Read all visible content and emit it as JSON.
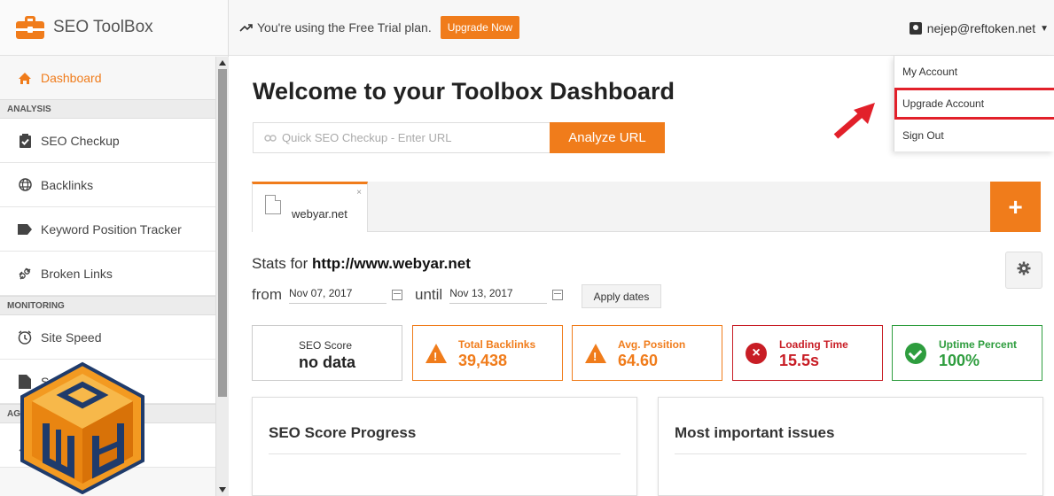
{
  "brand": {
    "name": "SEO ToolBox"
  },
  "sidebar": {
    "items": [
      {
        "label": "Dashboard",
        "icon": "home-icon",
        "active": true
      },
      {
        "section": "ANALYSIS"
      },
      {
        "label": "SEO Checkup",
        "icon": "clipboard-check-icon"
      },
      {
        "label": "Backlinks",
        "icon": "globe-icon"
      },
      {
        "label": "Keyword Position Tracker",
        "icon": "tag-icon"
      },
      {
        "label": "Broken Links",
        "icon": "broken-link-icon"
      },
      {
        "section": "MONITORING"
      },
      {
        "label": "Site Speed",
        "icon": "clock-icon"
      },
      {
        "label": "S",
        "icon": "file-icon"
      },
      {
        "section": "AGE"
      }
    ]
  },
  "topbar": {
    "trial_text": "You're using the Free Trial plan.",
    "upgrade_label": "Upgrade Now",
    "user_email": "nejep@reftoken.net"
  },
  "dropdown": {
    "items": [
      "My Account",
      "Upgrade Account",
      "Sign Out"
    ]
  },
  "main": {
    "title": "Welcome to your Toolbox Dashboard",
    "search": {
      "placeholder": "Quick SEO Checkup - Enter URL",
      "button": "Analyze URL"
    },
    "tab": {
      "label": "webyar.net",
      "close": "×"
    },
    "add_tab": "+",
    "stats_prefix": "Stats for",
    "stats_url": "http://www.webyar.net",
    "from_label": "from",
    "from_date": "Nov 07, 2017",
    "until_label": "until",
    "until_date": "Nov 13, 2017",
    "apply_label": "Apply dates",
    "cards": [
      {
        "label": "SEO Score",
        "value": "no data",
        "status": "neutral"
      },
      {
        "label": "Total Backlinks",
        "value": "39,438",
        "status": "warning"
      },
      {
        "label": "Avg. Position",
        "value": "64.60",
        "status": "warning"
      },
      {
        "label": "Loading Time",
        "value": "15.5s",
        "status": "error"
      },
      {
        "label": "Uptime Percent",
        "value": "100%",
        "status": "ok"
      }
    ],
    "panels": [
      "SEO Score Progress",
      "Most important issues"
    ]
  },
  "colors": {
    "accent": "#f07c1b",
    "error": "#c81d25",
    "ok": "#2e9d3e",
    "highlight": "#e2202a"
  }
}
